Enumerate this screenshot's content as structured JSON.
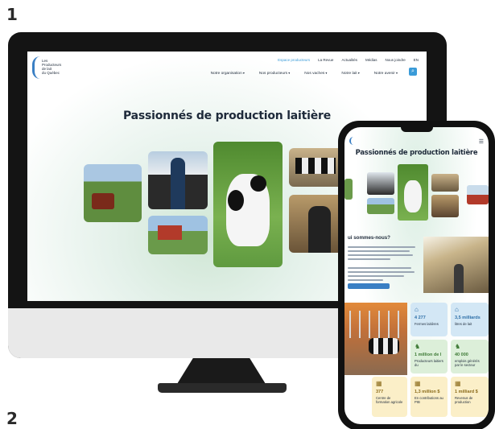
{
  "steps": {
    "one": "1",
    "two": "2"
  },
  "desktop": {
    "logo_text": "Les\nProducteurs\nde lait\ndu Québec",
    "utility_nav": [
      "Espace producteurs",
      "La Revue",
      "Actualités",
      "Médias",
      "Nous joindre",
      "EN"
    ],
    "main_nav": [
      "Notre organisation",
      "Nos producteurs",
      "Nos vaches",
      "Notre lait",
      "Notre avenir"
    ],
    "hero_title": "Passionnés de production laitière",
    "accent_color": "#3a9bd8"
  },
  "phone": {
    "hero_title": "Passionnés de production laitière",
    "section_heading": "ui sommes-nous?",
    "stats": [
      {
        "icon": "barn-icon",
        "value": "4 277",
        "label": "Fermes laitières",
        "tone": "blue"
      },
      {
        "icon": "barn-icon",
        "value": "3,5 milliards",
        "label": "litres de lait",
        "tone": "blue"
      },
      {
        "icon": "cow-icon",
        "value": "1 million de l",
        "label": "Producteurs laitiers du",
        "tone": "green"
      },
      {
        "icon": "cow-icon",
        "value": "40 000",
        "label": "emplois générés par le secteur",
        "tone": "green"
      },
      {
        "icon": "fence-icon",
        "value": "377",
        "label": "Centre de formation agricole",
        "tone": "yellow"
      },
      {
        "icon": "fence-icon",
        "value": "1,3 million $",
        "label": "En contributions au PIB",
        "tone": "yellow"
      },
      {
        "icon": "fence-icon",
        "value": "1 milliard $",
        "label": "Revenus de production",
        "tone": "yellow"
      }
    ]
  }
}
